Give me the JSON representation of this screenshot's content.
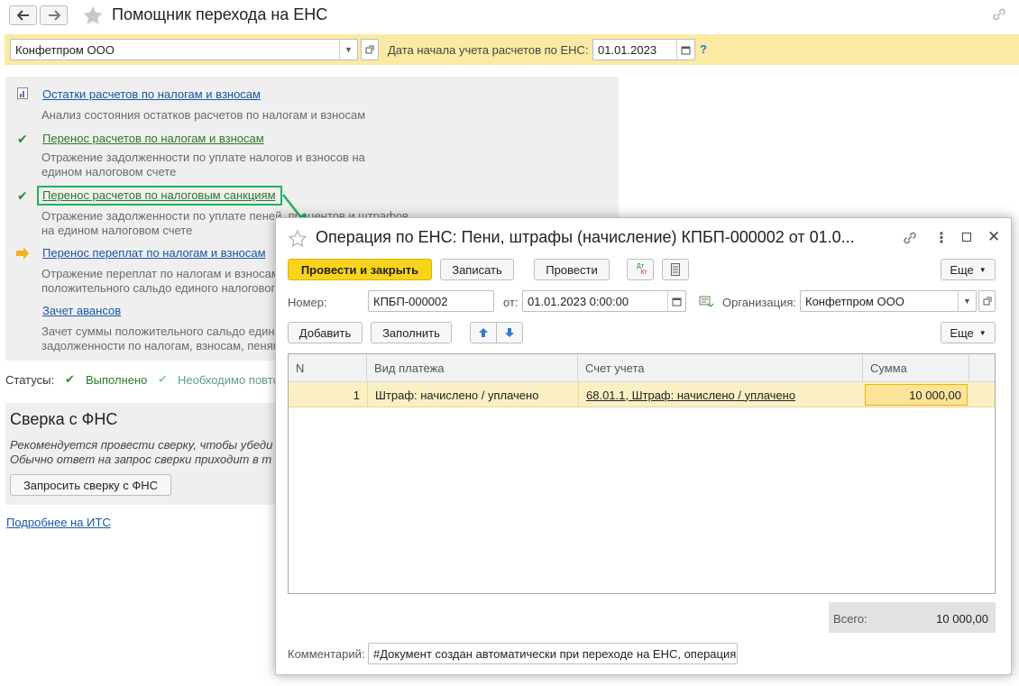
{
  "header": {
    "title": "Помощник перехода на ЕНС",
    "back_glyph": "🡐",
    "forward_glyph": "🡒"
  },
  "filter": {
    "organization": "Конфетпром ООО",
    "date_label": "Дата начала учета расчетов по ЕНС:",
    "date_value": "01.01.2023",
    "help": "?"
  },
  "steps": [
    {
      "link": "Остатки расчетов по налогам и взносам",
      "desc": "Анализ состояния остатков расчетов по налогам и взносам",
      "icon": "report-icon"
    },
    {
      "link": "Перенос расчетов по налогам и взносам",
      "desc1": "Отражение задолженности по уплате налогов и взносов на",
      "desc2": "едином налоговом счете",
      "icon": "check-icon"
    },
    {
      "link": "Перенос расчетов по налоговым санкциям",
      "desc1": "Отражение задолженности по уплате пеней, процентов и штрафов",
      "desc2": "на едином налоговом счете",
      "icon": "check-icon"
    },
    {
      "link": "Перенос переплат по налогам и взносам",
      "desc1": "Отражение переплат по налогам и взносам",
      "desc2": "положительного сальдо единого налогового",
      "icon": "arrow-right-icon"
    },
    {
      "link": "Зачет авансов",
      "desc1": "Зачет суммы положительного сальдо един",
      "desc2": "задолженности по налогам, взносам, пеням"
    }
  ],
  "statuses": {
    "label": "Статусы:",
    "done": "Выполнено",
    "needed": "Необходимо повто"
  },
  "fns": {
    "title": "Сверка с ФНС",
    "text1": "Рекомендуется провести сверку, чтобы убеди",
    "text2": "Обычно ответ на запрос сверки приходит в т",
    "button": "Запросить сверку с ФНС"
  },
  "more_link": "Подробнее на ИТС",
  "dialog": {
    "title": "Операция по ЕНС: Пени, штрафы (начисление) КПБП-000002 от 01.0...",
    "toolbar": {
      "post_close": "Провести и закрыть",
      "save": "Записать",
      "post": "Провести",
      "dt": "Дт",
      "kt": "Кт",
      "more": "Еще"
    },
    "number_label": "Номер:",
    "number_value": "КПБП-000002",
    "from_label": "от:",
    "from_value": "01.01.2023  0:00:00",
    "org_label": "Организация:",
    "org_value": "Конфетпром ООО",
    "add": "Добавить",
    "fill": "Заполнить",
    "more2": "Еще",
    "columns": [
      "N",
      "Вид платежа",
      "Счет учета",
      "Сумма"
    ],
    "rows": [
      {
        "n": "1",
        "type": "Штраф: начислено / уплачено",
        "account": "68.01.1, Штраф: начислено / уплачено",
        "sum": "10 000,00"
      }
    ],
    "total_label": "Всего:",
    "total_value": "10 000,00",
    "comment_label": "Комментарий:",
    "comment_value": "#Документ создан автоматически при переходе на ЕНС, операция"
  },
  "colors": {
    "accent_green": "#1fb35e",
    "yellow_bar": "#fbeaa4",
    "primary_button": "#f9d41c",
    "selected_row": "#fbf0c4"
  }
}
